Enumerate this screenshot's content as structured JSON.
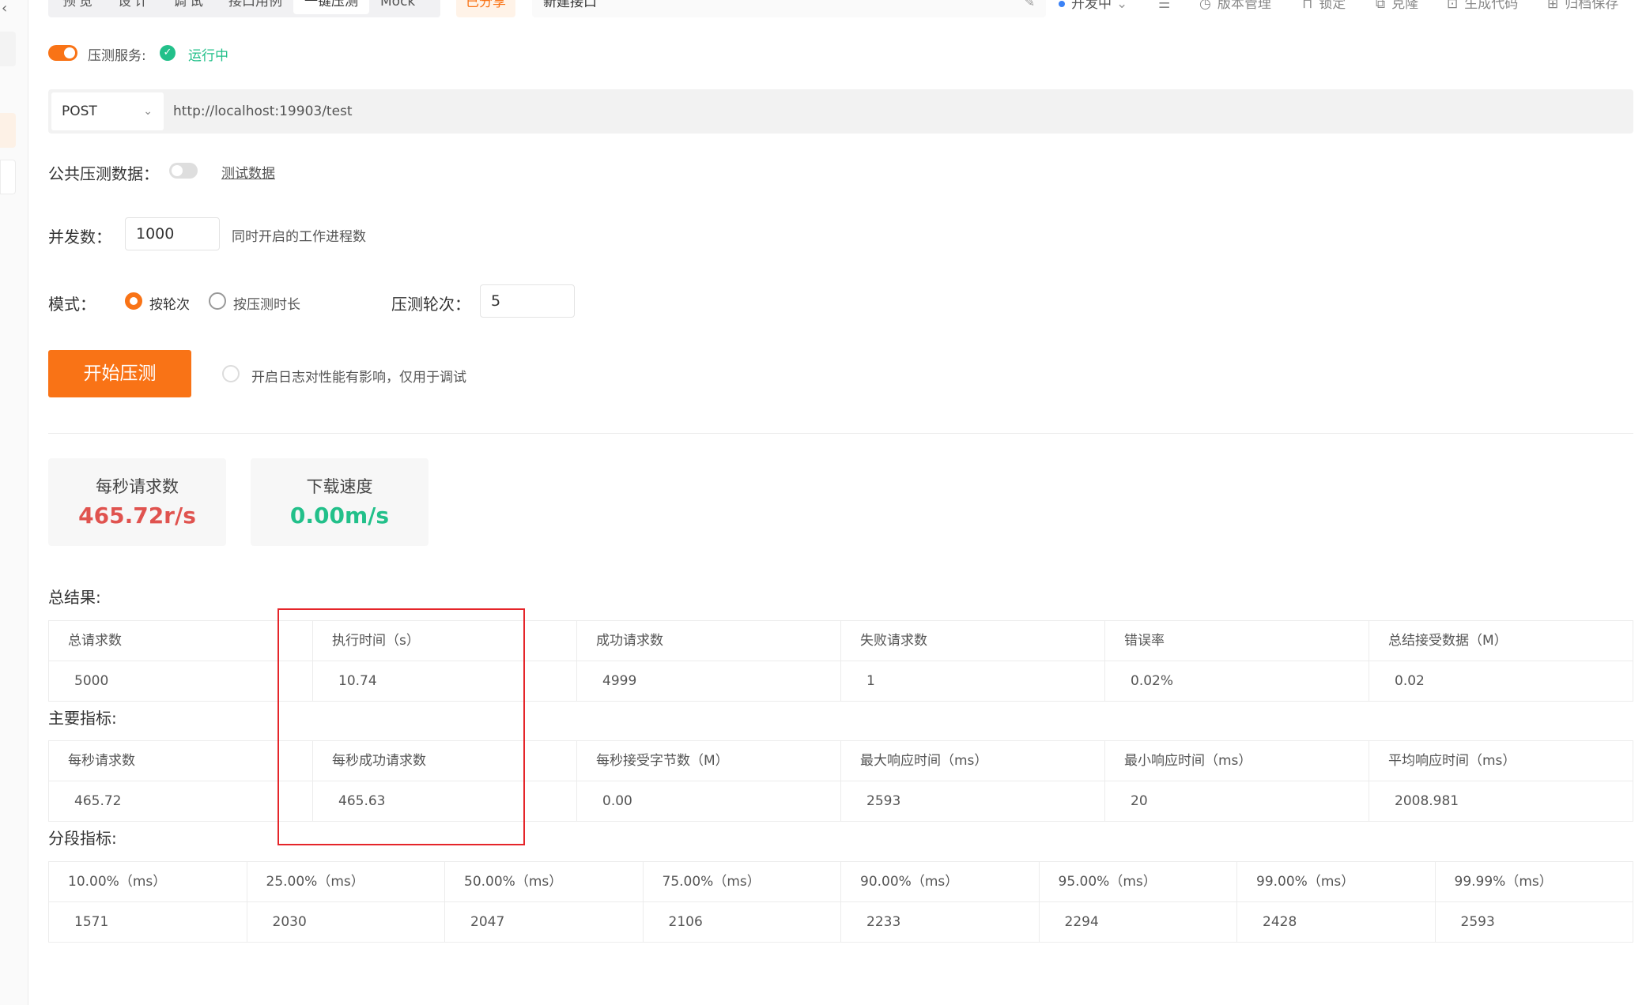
{
  "toolbar": {
    "tabs": [
      "预览",
      "设计",
      "调试",
      "接口用例",
      "一键压测",
      "Mock"
    ],
    "active_tab": "一键压测",
    "share_label": "已分享",
    "api_name": "新建接口",
    "status": "开发中",
    "items": [
      "版本管理",
      "锁定",
      "克隆",
      "生成代码",
      "归档保存"
    ]
  },
  "service": {
    "label": "压测服务:",
    "status": "运行中"
  },
  "request": {
    "method": "POST",
    "url": "http://localhost:19903/test"
  },
  "public_data": {
    "label": "公共压测数据：",
    "link": "测试数据"
  },
  "concurrency": {
    "label": "并发数：",
    "value": "1000",
    "hint": "同时开启的工作进程数"
  },
  "mode": {
    "label": "模式：",
    "options": [
      "按轮次",
      "按压测时长"
    ],
    "selected": "按轮次",
    "rounds_label": "压测轮次：",
    "rounds_value": "5"
  },
  "actions": {
    "start_label": "开始压测",
    "log_label": "开启日志对性能有影响，仅用于调试"
  },
  "stats": {
    "rps_title": "每秒请求数",
    "rps_value": "465.72r/s",
    "download_title": "下载速度",
    "download_value": "0.00m/s"
  },
  "summary": {
    "title": "总结果:",
    "headers": [
      "总请求数",
      "执行时间（s）",
      "成功请求数",
      "失败请求数",
      "错误率",
      "总结接受数据（M）"
    ],
    "values": [
      "5000",
      "10.74",
      "4999",
      "1",
      "0.02%",
      "0.02"
    ]
  },
  "main_metrics": {
    "title": "主要指标:",
    "headers": [
      "每秒请求数",
      "每秒成功请求数",
      "每秒接受字节数（M）",
      "最大响应时间（ms）",
      "最小响应时间（ms）",
      "平均响应时间（ms）"
    ],
    "values": [
      "465.72",
      "465.63",
      "0.00",
      "2593",
      "20",
      "2008.981"
    ]
  },
  "percentiles": {
    "title": "分段指标:",
    "headers": [
      "10.00%（ms）",
      "25.00%（ms）",
      "50.00%（ms）",
      "75.00%（ms）",
      "90.00%（ms）",
      "95.00%（ms）",
      "99.00%（ms）",
      "99.99%（ms）"
    ],
    "values": [
      "1571",
      "2030",
      "2047",
      "2106",
      "2233",
      "2294",
      "2428",
      "2593"
    ]
  },
  "colors": {
    "accent": "#f97316",
    "success": "#22c08a",
    "rps_value": "#e0534f",
    "download_value": "#22c08a",
    "highlight_box": "#e5252a"
  },
  "icons": {
    "status_dot": "dot-icon",
    "edit": "edit-icon",
    "list": "list-icon"
  }
}
